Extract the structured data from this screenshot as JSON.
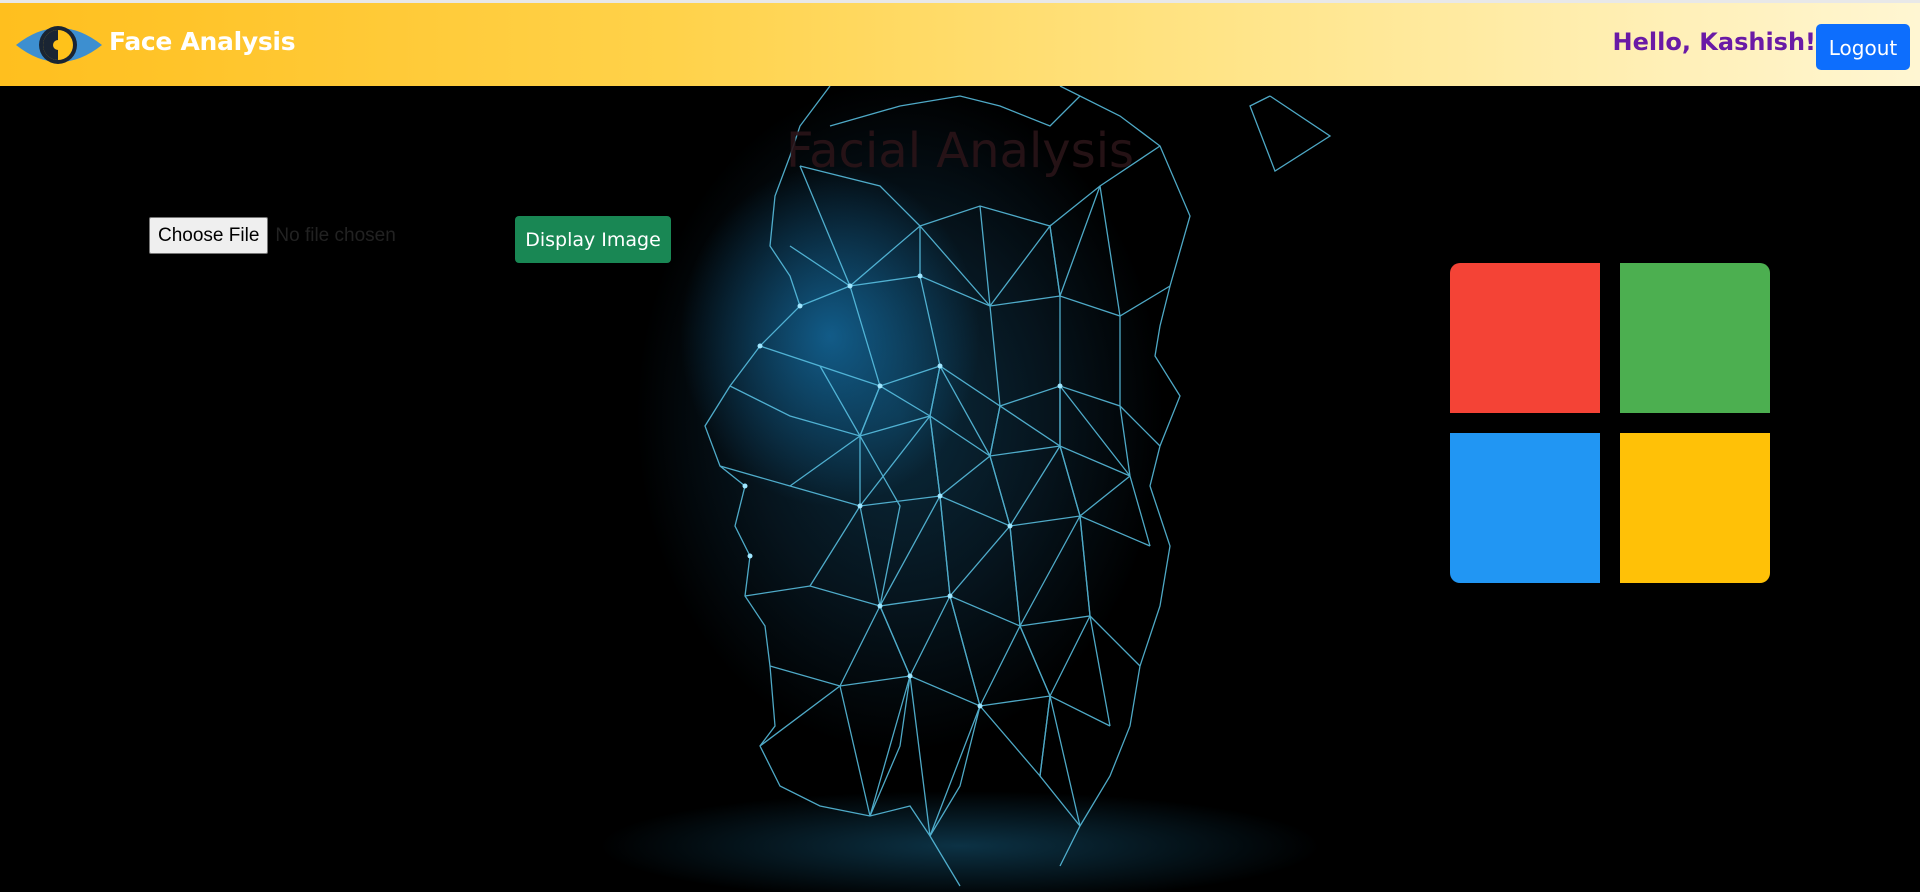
{
  "navbar": {
    "brand_title": "Face Analysis",
    "greeting": "Hello, Kashish!",
    "logout_label": "Logout",
    "logo_icon": "eye-icon"
  },
  "main": {
    "heading": "Facial Analysis",
    "file_input": {
      "button_label": "Choose File",
      "status_text": "No file chosen"
    },
    "display_button_label": "Display Image",
    "hero_image": "wireframe-face-profile"
  },
  "tiles": {
    "colors": [
      "#f44336",
      "#4caf50",
      "#2196f3",
      "#ffc107"
    ],
    "icon": "microsoft-logo-icon"
  },
  "colors": {
    "navbar_gradient_start": "#ffbf1e",
    "navbar_gradient_end": "#fff6d2",
    "greeting_color": "#6a1aa6",
    "logout_button": "#0d6efd",
    "display_button": "#198754"
  }
}
